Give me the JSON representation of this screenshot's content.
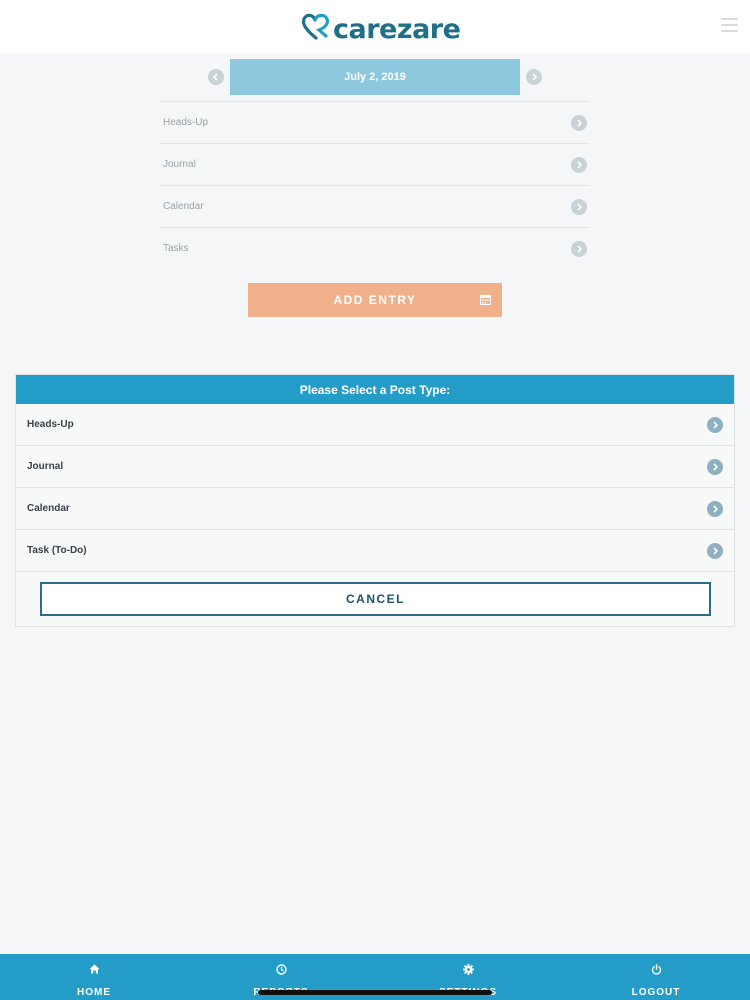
{
  "brand": {
    "name": "carezare",
    "colors": {
      "primary": "#239dc7",
      "logo": "#1f6f86",
      "accent": "#f0b18a"
    }
  },
  "header": {
    "menu_icon": "hamburger-icon"
  },
  "date_nav": {
    "date": "July 2, 2019",
    "prev_icon": "chevron-left-icon",
    "next_icon": "chevron-right-icon"
  },
  "background_list": [
    {
      "label": "Heads-Up"
    },
    {
      "label": "Journal"
    },
    {
      "label": "Calendar"
    },
    {
      "label": "Tasks"
    }
  ],
  "add_entry": {
    "label": "ADD ENTRY",
    "icon": "calendar-icon"
  },
  "modal": {
    "title": "Please Select a Post Type:",
    "options": [
      {
        "label": "Heads-Up"
      },
      {
        "label": "Journal"
      },
      {
        "label": "Calendar"
      },
      {
        "label": "Task (To-Do)"
      }
    ],
    "cancel_label": "CANCEL"
  },
  "bottom_nav": [
    {
      "label": "HOME",
      "icon": "home-icon"
    },
    {
      "label": "REPORTS",
      "icon": "clock-icon"
    },
    {
      "label": "SETTINGS",
      "icon": "gear-icon"
    },
    {
      "label": "LOGOUT",
      "icon": "power-icon"
    }
  ]
}
